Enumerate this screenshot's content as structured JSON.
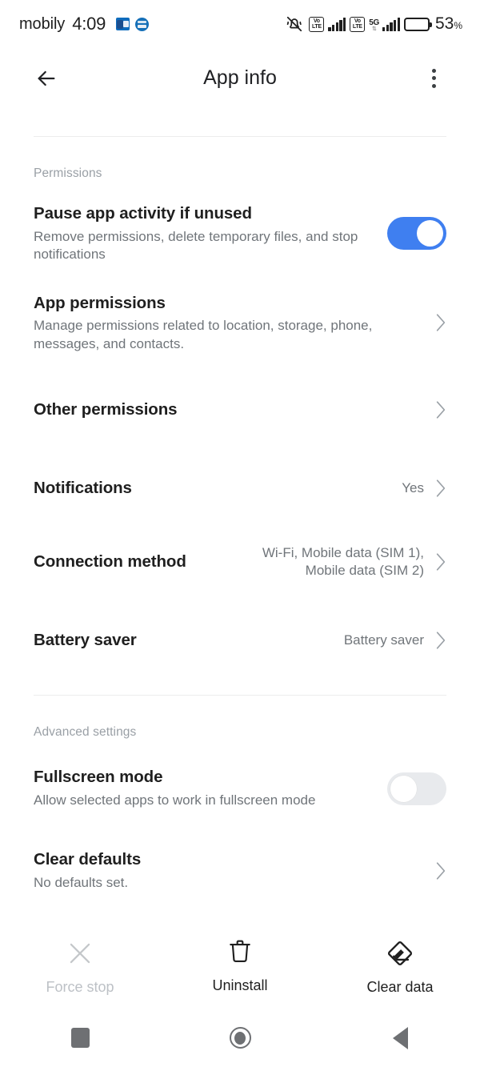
{
  "status_bar": {
    "carrier": "mobily",
    "clock": "4:09",
    "app_icons": [
      "outlook-icon",
      "blue-app-icon"
    ],
    "mute_icon": "bell-muted-icon",
    "sim1_volte": {
      "top": "Vo",
      "bottom": "LTE"
    },
    "sim2_volte": {
      "top": "Vo",
      "bottom": "LTE"
    },
    "network_5g": "5G",
    "network_5g_arrows": "⇅",
    "battery_percent": "53",
    "battery_percent_unit": "%",
    "battery_level": 53
  },
  "app_bar": {
    "back_icon": "arrow-left-icon",
    "title": "App info",
    "overflow_icon": "more-vertical-icon"
  },
  "sections": {
    "permissions_label": "Permissions",
    "advanced_label": "Advanced settings"
  },
  "rows": {
    "pause_app_activity": {
      "title": "Pause app activity if unused",
      "subtitle": "Remove permissions, delete temporary files, and stop notifications",
      "toggle": "on"
    },
    "app_permissions": {
      "title": "App permissions",
      "subtitle": "Manage permissions related to location, storage, phone, messages, and contacts.",
      "chevron": "chevron-right-icon"
    },
    "other_permissions": {
      "title": "Other permissions",
      "chevron": "chevron-right-icon"
    },
    "notifications": {
      "title": "Notifications",
      "value": "Yes",
      "chevron": "chevron-right-icon"
    },
    "connection_method": {
      "title": "Connection method",
      "value": "Wi-Fi, Mobile data (SIM 1),\nMobile data (SIM 2)",
      "chevron": "chevron-right-icon"
    },
    "battery_saver": {
      "title": "Battery saver",
      "value": "Battery saver",
      "chevron": "chevron-right-icon"
    },
    "fullscreen_mode": {
      "title": "Fullscreen mode",
      "subtitle": "Allow selected apps to work in fullscreen mode",
      "toggle": "off"
    },
    "clear_defaults": {
      "title": "Clear defaults",
      "subtitle": "No defaults set.",
      "chevron": "chevron-right-icon"
    }
  },
  "actions": [
    {
      "label": "Force stop",
      "icon": "close-x-icon",
      "enabled": false
    },
    {
      "label": "Uninstall",
      "icon": "trash-icon",
      "enabled": true
    },
    {
      "label": "Clear data",
      "icon": "eraser-icon",
      "enabled": true
    }
  ],
  "nav_bar": {
    "recents": "square-icon",
    "home": "circle-icon",
    "back": "triangle-left-icon"
  },
  "colors": {
    "toggle_on": "#3f7ff0",
    "toggle_off": "#e8eaed",
    "title_text": "#1f1f1f",
    "secondary_text": "#70757a",
    "section_label": "#9aa0a6",
    "divider": "#eceded",
    "disabled_text": "#bdc1c6",
    "nav_icon": "#6e7073"
  }
}
